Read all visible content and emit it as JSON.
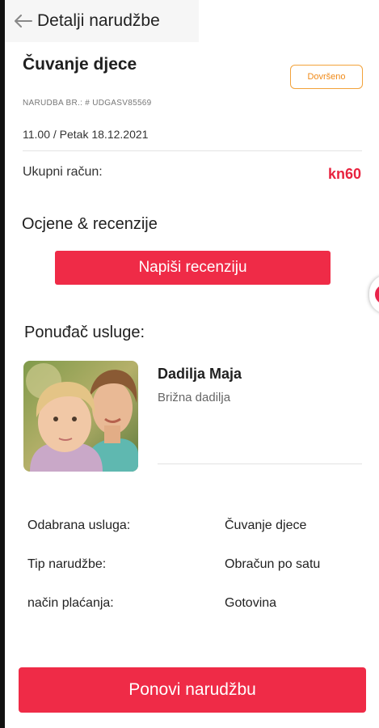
{
  "header": {
    "back_icon": "arrow-left-icon",
    "title": "Detalji narudžbe"
  },
  "order": {
    "service_title": "Čuvanje djece",
    "status_badge": "Dovršeno",
    "order_number": "NARUDBA BR.: # UDGASV85569",
    "datetime": "11.00 /  Petak 18.12.2021",
    "total_label": "Ukupni račun:",
    "total_value": "kn60"
  },
  "reviews": {
    "title": "Ocjene & recenzije",
    "button_label": "Napiši recenziju"
  },
  "provider": {
    "section_title": "Ponuđač usluge:",
    "photo": "caregiver-with-child-photo",
    "name": "Dadilja Maja",
    "role": "Brižna dadilja"
  },
  "details": [
    {
      "label": "Odabrana usluga:",
      "value": "Čuvanje djece"
    },
    {
      "label": "Tip narudžbe:",
      "value": "Obračun po satu"
    },
    {
      "label": "način plaćanja:",
      "value": "Gotovina"
    }
  ],
  "footer": {
    "repeat_button_label": "Ponovi narudžbu"
  },
  "colors": {
    "accent": "#ef2b47",
    "total": "#e8233f",
    "status": "#f08a18"
  }
}
